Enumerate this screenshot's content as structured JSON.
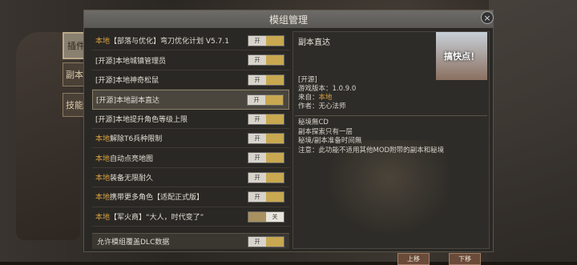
{
  "window": {
    "title": "模组管理",
    "close_icon": "×"
  },
  "side_tabs": [
    {
      "label": "插件"
    },
    {
      "label": "副本"
    },
    {
      "label": "技能"
    }
  ],
  "mods": [
    {
      "prefix": "本地",
      "name": "【部落与优化】弯刀优化计划 V5.7.1",
      "toggle": "开",
      "on": true
    },
    {
      "prefix": "[开源]本地",
      "name": "城镇管理员",
      "toggle": "开",
      "on": true
    },
    {
      "prefix": "[开源]本地",
      "name": "神奇松鼠",
      "toggle": "开",
      "on": true
    },
    {
      "prefix": "[开源]本地",
      "name": "副本直达",
      "toggle": "开",
      "on": true,
      "selected": true
    },
    {
      "prefix": "[开源]本地",
      "name": "提升角色等级上限",
      "toggle": "开",
      "on": true
    },
    {
      "prefix": "本地",
      "name": "解除T6兵种限制",
      "toggle": "开",
      "on": true
    },
    {
      "prefix": "本地",
      "name": "自动点亮地图",
      "toggle": "开",
      "on": true
    },
    {
      "prefix": "本地",
      "name": "装备无限耐久",
      "toggle": "开",
      "on": true
    },
    {
      "prefix": "本地",
      "name": "携带更多角色【适配正式版】",
      "toggle": "开",
      "on": true
    },
    {
      "prefix": "本地",
      "name": "【军火商】“大人，时代变了”",
      "toggle": "关",
      "on": false
    }
  ],
  "footer": {
    "label": "允许模组覆盖DLC数据",
    "toggle": "开"
  },
  "detail": {
    "title": "副本直达",
    "thumb_text": "搞快点！",
    "meta": [
      {
        "text": "[开源]"
      },
      {
        "text": "游戏版本：1.0.9.0"
      },
      {
        "label": "来自：",
        "value": "本地"
      },
      {
        "text": "作者：无心法师"
      }
    ],
    "desc": [
      "秘境無CD",
      "副本探索只有一层",
      "秘境/副本准备时间無",
      "注意：此功能不适用其他MOD附带的副本和秘境"
    ],
    "up_button": "上移",
    "down_button": "下移"
  }
}
